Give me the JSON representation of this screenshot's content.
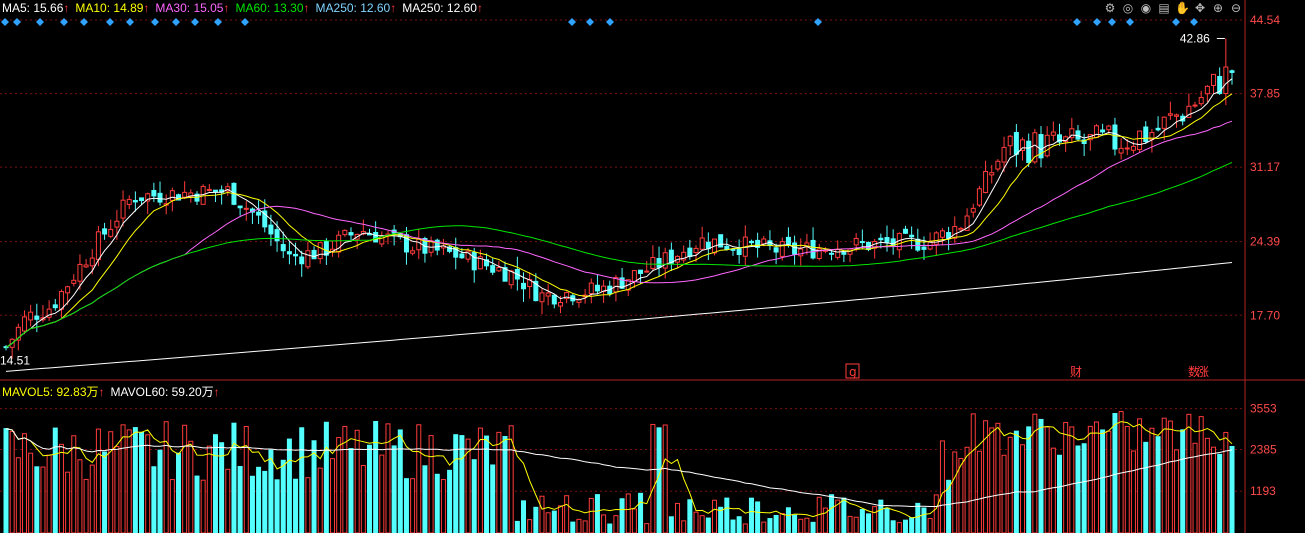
{
  "price_legend": [
    {
      "label": "MA5: 15.66",
      "color": "#ffffff"
    },
    {
      "label": "MA10: 14.89",
      "color": "#ffff00"
    },
    {
      "label": "MA30: 15.05",
      "color": "#ff66ff"
    },
    {
      "label": "MA60: 13.30",
      "color": "#00e600"
    },
    {
      "label": "MA250: 12.60",
      "color": "#7fd4ff"
    },
    {
      "label": "MA250: 12.60",
      "color": "#ffffff"
    }
  ],
  "volume_legend": [
    {
      "label": "MAVOL5: 92.83万",
      "color": "#ffff00"
    },
    {
      "label": "MAVOL60: 59.20万",
      "color": "#ffffff"
    }
  ],
  "arrow_color": "#ff3b3b",
  "toolbar_icons": [
    "settings-icon",
    "target-icon",
    "eye-icon",
    "shop-icon",
    "hand-icon",
    "expand-icon",
    "zoom-in-icon",
    "zoom-out-icon"
  ],
  "toolbar_glyphs": [
    "⚙",
    "◎",
    "◉",
    "▤",
    "✋",
    "✥",
    "⊕",
    "⊖"
  ],
  "markers": {
    "g_label": "g",
    "cai_label": "财",
    "zhang_label": "涨",
    "zhang_prefix_label": "数"
  },
  "chart_data": [
    {
      "type": "candlestick",
      "price_ticks": [
        "44.54",
        "37.85",
        "31.17",
        "24.39",
        "17.70"
      ],
      "ylim": [
        12.0,
        44.54
      ],
      "max_label": "42.86",
      "min_label": "14.51",
      "approx_candles": 200,
      "closes_anchor": {
        "start": 15.0,
        "mid_peak": 30.5,
        "low": 19.8,
        "end": 40.0
      },
      "ma_series": [
        {
          "name": "MA5",
          "color": "#ffffff"
        },
        {
          "name": "MA10",
          "color": "#ffff00"
        },
        {
          "name": "MA30",
          "color": "#ff66ff"
        },
        {
          "name": "MA60",
          "color": "#00e600"
        },
        {
          "name": "MA250",
          "color": "#ffffff"
        }
      ]
    },
    {
      "type": "bar",
      "volume_ticks": [
        "3553",
        "2385",
        "1193"
      ],
      "ylim": [
        0,
        3800
      ],
      "ma_series": [
        {
          "name": "MAVOL5",
          "color": "#ffff00"
        },
        {
          "name": "MAVOL60",
          "color": "#ffffff"
        }
      ]
    }
  ]
}
